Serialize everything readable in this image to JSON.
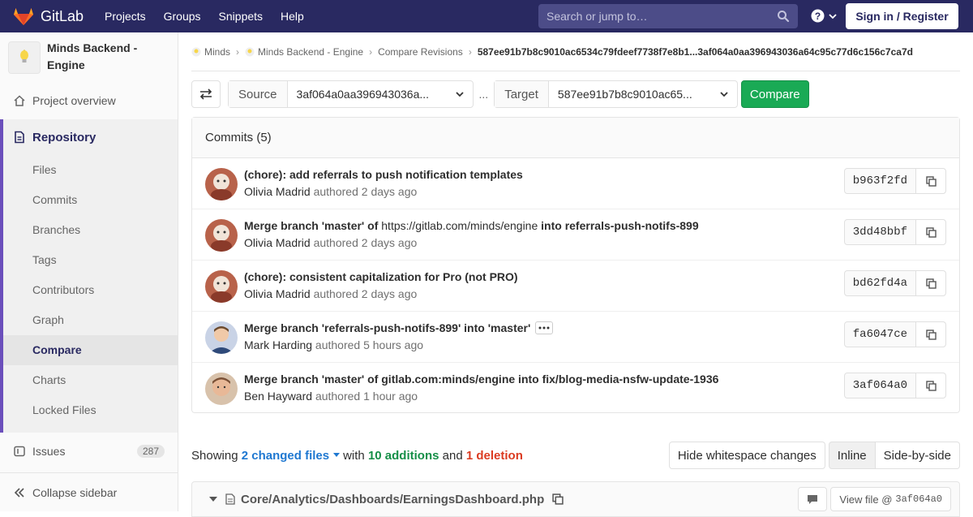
{
  "navbar": {
    "brand": "GitLab",
    "links": [
      "Projects",
      "Groups",
      "Snippets",
      "Help"
    ],
    "search_placeholder": "Search or jump to…",
    "signin": "Sign in / Register"
  },
  "sidebar": {
    "project_name": "Minds Backend - Engine",
    "overview": "Project overview",
    "repository": "Repository",
    "repo_items": [
      "Files",
      "Commits",
      "Branches",
      "Tags",
      "Contributors",
      "Graph",
      "Compare",
      "Charts",
      "Locked Files"
    ],
    "active_item": "Compare",
    "issues": "Issues",
    "issues_count": "287",
    "collapse": "Collapse sidebar"
  },
  "breadcrumb": {
    "items": [
      "Minds",
      "Minds Backend - Engine",
      "Compare Revisions"
    ],
    "current": "587ee91b7b8c9010ac6534c79fdeef7738f7e8b1...3af064a0aa396943036a64c95c77d6c156c7ca7d"
  },
  "compare": {
    "source_label": "Source",
    "source_value": "3af064a0aa396943036a...",
    "separator": "...",
    "target_label": "Target",
    "target_value": "587ee91b7b8c9010ac65...",
    "button": "Compare"
  },
  "commits": {
    "header": "Commits (5)",
    "list": [
      {
        "title": "(chore): add referrals to push notification templates",
        "title_plain": "",
        "title_after": "",
        "author": "Olivia Madrid",
        "verb": "authored",
        "time": "2 days ago",
        "sha": "b963f2fd"
      },
      {
        "title": "Merge branch 'master' of ",
        "title_plain": "https://gitlab.com/minds/engine",
        "title_after": " into referrals-push-notifs-899",
        "author": "Olivia Madrid",
        "verb": "authored",
        "time": "2 days ago",
        "sha": "3dd48bbf"
      },
      {
        "title": "(chore): consistent capitalization for Pro (not PRO)",
        "title_plain": "",
        "title_after": "",
        "author": "Olivia Madrid",
        "verb": "authored",
        "time": "2 days ago",
        "sha": "bd62fd4a"
      },
      {
        "title": "Merge branch 'referrals-push-notifs-899' into 'master'",
        "title_plain": "",
        "title_after": "",
        "author": "Mark Harding",
        "verb": "authored",
        "time": "5 hours ago",
        "sha": "fa6047ce"
      },
      {
        "title": "Merge branch 'master' of gitlab.com:minds/engine into fix/blog-media-nsfw-update-1936",
        "title_plain": "",
        "title_after": "",
        "author": "Ben Hayward",
        "verb": "authored",
        "time": "1 hour ago",
        "sha": "3af064a0"
      }
    ]
  },
  "summary": {
    "showing": "Showing",
    "changed": "2 changed files",
    "with": "with",
    "additions": "10 additions",
    "and": "and",
    "deletions": "1 deletion",
    "hide_ws": "Hide whitespace changes",
    "inline": "Inline",
    "side_by_side": "Side-by-side"
  },
  "file": {
    "path": "Core/Analytics/Dashboards/EarningsDashboard.php",
    "view_file": "View file @",
    "view_sha": "3af064a0"
  },
  "colors": {
    "navbar": "#292961",
    "accent": "#6b4fbb",
    "compare_button": "#1aaa55",
    "link": "#1f78d1",
    "additions": "#168f48",
    "deletions": "#db3b21"
  }
}
